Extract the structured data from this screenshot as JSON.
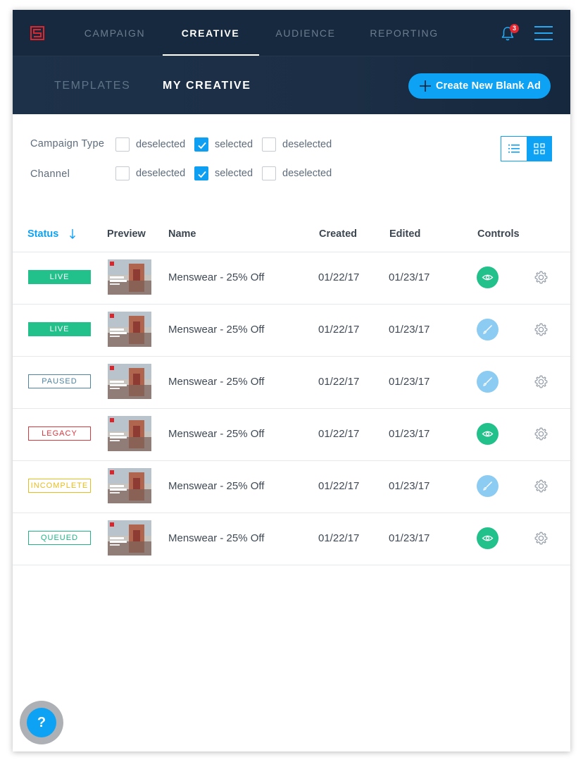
{
  "nav": {
    "items": [
      {
        "label": "CAMPAIGN",
        "active": false
      },
      {
        "label": "CREATIVE",
        "active": true
      },
      {
        "label": "AUDIENCE",
        "active": false
      },
      {
        "label": "REPORTING",
        "active": false
      }
    ],
    "notification_count": "3"
  },
  "subnav": {
    "items": [
      {
        "label": "TEMPLATES",
        "active": false
      },
      {
        "label": "MY CREATIVE",
        "active": true
      }
    ],
    "create_button_label": "Create New Blank Ad"
  },
  "filters": [
    {
      "label": "Campaign Type",
      "options": [
        {
          "label": "deselected",
          "checked": false
        },
        {
          "label": "selected",
          "checked": true
        },
        {
          "label": "deselected",
          "checked": false
        }
      ]
    },
    {
      "label": "Channel",
      "options": [
        {
          "label": "deselected",
          "checked": false
        },
        {
          "label": "selected",
          "checked": true
        },
        {
          "label": "deselected",
          "checked": false
        }
      ]
    }
  ],
  "view_mode": "list",
  "table": {
    "columns": [
      "Status",
      "Preview",
      "Name",
      "Created",
      "Edited",
      "Controls"
    ],
    "sort_column": "Status",
    "rows": [
      {
        "status": "LIVE",
        "name": "Menswear - 25% Off",
        "created": "01/22/17",
        "edited": "01/23/17",
        "control": "view"
      },
      {
        "status": "LIVE",
        "name": "Menswear - 25% Off",
        "created": "01/22/17",
        "edited": "01/23/17",
        "control": "edit"
      },
      {
        "status": "PAUSED",
        "name": "Menswear - 25% Off",
        "created": "01/22/17",
        "edited": "01/23/17",
        "control": "edit"
      },
      {
        "status": "LEGACY",
        "name": "Menswear - 25% Off",
        "created": "01/22/17",
        "edited": "01/23/17",
        "control": "view"
      },
      {
        "status": "INCOMPLETE",
        "name": "Menswear - 25% Off",
        "created": "01/22/17",
        "edited": "01/23/17",
        "control": "edit"
      },
      {
        "status": "QUEUED",
        "name": "Menswear - 25% Off",
        "created": "01/22/17",
        "edited": "01/23/17",
        "control": "view"
      }
    ]
  },
  "status_styles": {
    "LIVE": {
      "bg": "#22c08a",
      "border": "#22c08a",
      "color": "#ffffff"
    },
    "PAUSED": {
      "bg": "#ffffff",
      "border": "#4f83a3",
      "color": "#4f83a3"
    },
    "LEGACY": {
      "bg": "#ffffff",
      "border": "#d9363e",
      "color": "#d9363e"
    },
    "INCOMPLETE": {
      "bg": "#ffffff",
      "border": "#e6bd1e",
      "color": "#e6bd1e"
    },
    "QUEUED": {
      "bg": "#ffffff",
      "border": "#22b487",
      "color": "#22b487"
    }
  },
  "control_styles": {
    "view": {
      "bg": "#22c08a",
      "icon": "eye-icon"
    },
    "edit": {
      "bg": "#8ccbf2",
      "icon": "brush-icon"
    }
  },
  "help_label": "?",
  "colors": {
    "accent": "#0ea2f4",
    "nav_bg": "#17293e"
  }
}
